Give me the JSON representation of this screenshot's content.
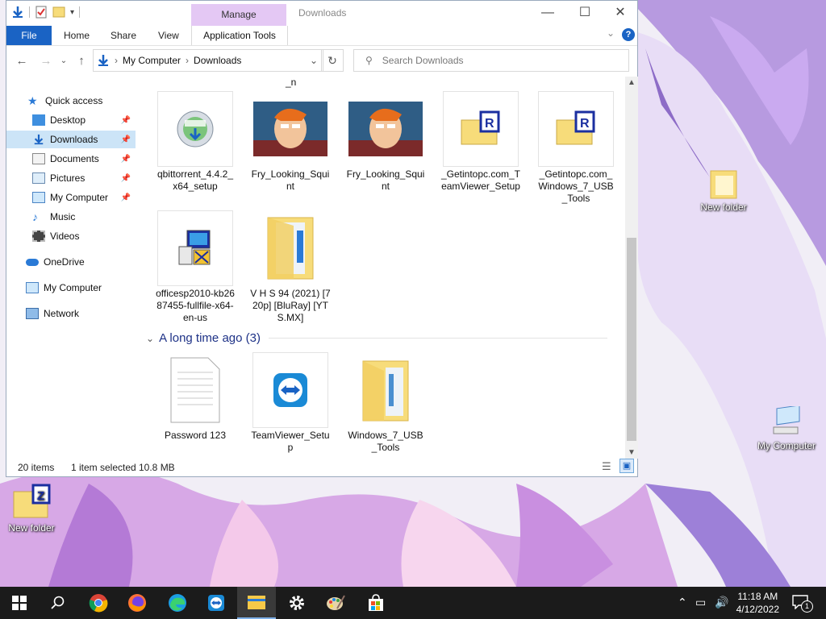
{
  "window": {
    "title": "Downloads",
    "manage_tab": "Manage",
    "ribbon_tabs": {
      "file": "File",
      "home": "Home",
      "share": "Share",
      "view": "View",
      "app_tools": "Application Tools"
    },
    "help": "?"
  },
  "address": {
    "root": "My Computer",
    "current": "Downloads"
  },
  "search": {
    "placeholder": "Search Downloads"
  },
  "nav": {
    "quick_access": "Quick access",
    "items": [
      "Desktop",
      "Downloads",
      "Documents",
      "Pictures",
      "My Computer",
      "Music",
      "Videos"
    ],
    "onedrive": "OneDrive",
    "my_computer": "My Computer",
    "network": "Network"
  },
  "content": {
    "partial_label": "_n",
    "files": [
      {
        "name": "qbittorrent_4.4.2_x64_setup",
        "icon": "installer-disc-icon"
      },
      {
        "name": "Fry_Looking_Squint",
        "icon": "image-thumbnail"
      },
      {
        "name": "Fry_Looking_Squint",
        "icon": "image-thumbnail"
      },
      {
        "name": "_Getintopc.com_TeamViewer_Setup",
        "icon": "winrar-archive-icon"
      },
      {
        "name": "_Getintopc.com_Windows_7_USB_Tools",
        "icon": "winrar-archive-icon"
      },
      {
        "name": "officesp2010-kb2687455-fullfile-x64-en-us",
        "icon": "setup-computer-icon"
      },
      {
        "name": "V H S 94 (2021) [720p] [BluRay] [YTS.MX]",
        "icon": "folder-icon"
      }
    ],
    "group_header": "A long time ago (3)",
    "old_files": [
      {
        "name": "Password 123",
        "icon": "text-document-icon"
      },
      {
        "name": "TeamViewer_Setup",
        "icon": "teamviewer-icon"
      },
      {
        "name": "Windows_7_USB_Tools",
        "icon": "folder-icon"
      }
    ]
  },
  "status": {
    "count": "20 items",
    "selected": "1 item selected",
    "size": "10.8 MB"
  },
  "desktop": {
    "icons": [
      "New folder",
      "My Computer",
      "New folder"
    ]
  },
  "taskbar": {
    "time": "11:18 AM",
    "date": "4/12/2022",
    "notifications": "1"
  },
  "colors": {
    "accent": "#1a63c4",
    "manage_tab": "#e4c8f4",
    "selection": "#cce4f7",
    "taskbar": "#1b1b1b"
  }
}
